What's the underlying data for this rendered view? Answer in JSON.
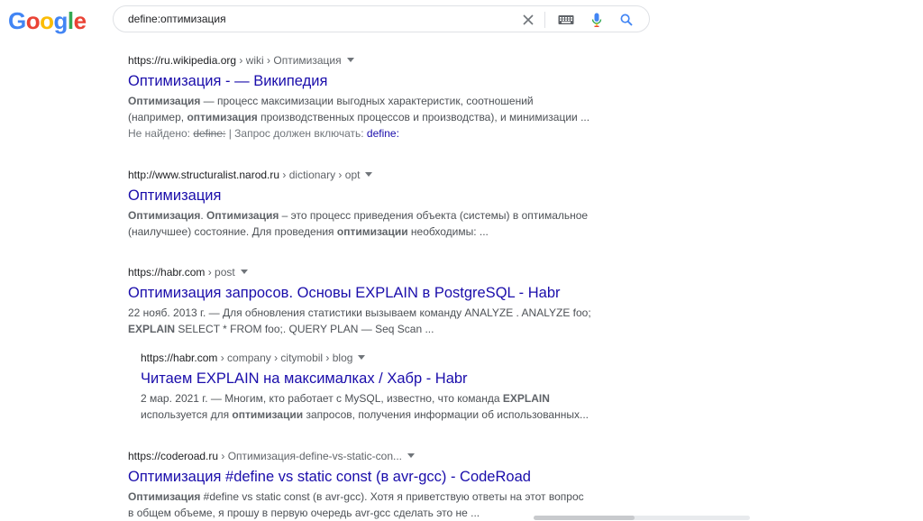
{
  "logo": {
    "text": [
      "G",
      "o",
      "o",
      "g",
      "l",
      "e"
    ],
    "colors": [
      "#4285F4",
      "#EA4335",
      "#FBBC05",
      "#4285F4",
      "#34A853",
      "#EA4335"
    ]
  },
  "search": {
    "query": "define:оптимизация"
  },
  "icons": {
    "clear": "close-icon",
    "keyboard": "keyboard-icon",
    "mic": "microphone-icon",
    "search": "search-icon"
  },
  "results": [
    {
      "url": "https://ru.wikipedia.org",
      "crumbs": " › wiki › Оптимизация",
      "title": "Оптимизация - — Википедия",
      "snippet_lines": [
        [
          [
            "b",
            "Оптимизация"
          ],
          [
            "t",
            " — процесс максимизации выгодных характеристик, соотношений"
          ]
        ],
        [
          [
            "t",
            "(например, "
          ],
          [
            "b",
            "оптимизация"
          ],
          [
            "t",
            " производственных процессов и производства), и минимизации ..."
          ]
        ]
      ],
      "missing": {
        "label": "Не найдено: ",
        "struck": "define:",
        "sep": " | Запрос должен включать: ",
        "link": "define:"
      }
    },
    {
      "url": "http://www.structuralist.narod.ru",
      "crumbs": " › dictionary › opt",
      "title": "Оптимизация",
      "snippet_lines": [
        [
          [
            "b",
            "Оптимизация"
          ],
          [
            "t",
            ". "
          ],
          [
            "b",
            "Оптимизация"
          ],
          [
            "t",
            " – это процесс приведения объекта (системы) в оптимальное"
          ]
        ],
        [
          [
            "t",
            "(наилучшее) состояние. Для проведения "
          ],
          [
            "b",
            "оптимизации"
          ],
          [
            "t",
            " необходимы: ..."
          ]
        ]
      ]
    },
    {
      "url": "https://habr.com",
      "crumbs": " › post",
      "title": "Оптимизация запросов. Основы EXPLAIN в PostgreSQL - Habr",
      "snippet_lines": [
        [
          [
            "t",
            "22 нояб. 2013 г. — Для обновления статистики вызываем команду ANALYZE . ANALYZE foo;"
          ]
        ],
        [
          [
            "b",
            "EXPLAIN"
          ],
          [
            "t",
            " SELECT * FROM foo;. QUERY PLAN — Seq Scan ..."
          ]
        ]
      ]
    },
    {
      "url": "https://habr.com",
      "crumbs": " › company › citymobil › blog",
      "title": "Читаем EXPLAIN на максималках / Хабр - Habr",
      "snippet_lines": [
        [
          [
            "t",
            "2 мар. 2021 г. — Многим, кто работает с MySQL, известно, что команда "
          ],
          [
            "b",
            "EXPLAIN"
          ]
        ],
        [
          [
            "t",
            "используется для "
          ],
          [
            "b",
            "оптимизации"
          ],
          [
            "t",
            " запросов, получения информации об использованных..."
          ]
        ]
      ]
    },
    {
      "url": "https://coderoad.ru",
      "crumbs": " › Оптимизация-define-vs-static-con...",
      "title": "Оптимизация #define vs static const (в avr-gcc) - CodeRoad",
      "snippet_lines": [
        [
          [
            "b",
            "Оптимизация"
          ],
          [
            "t",
            " #define vs static const (в avr-gcc). Хотя я приветствую ответы на этот вопрос"
          ]
        ],
        [
          [
            "t",
            "в общем объеме, я прошу в первую очередь avr-gcc сделать это не ..."
          ]
        ]
      ]
    }
  ]
}
